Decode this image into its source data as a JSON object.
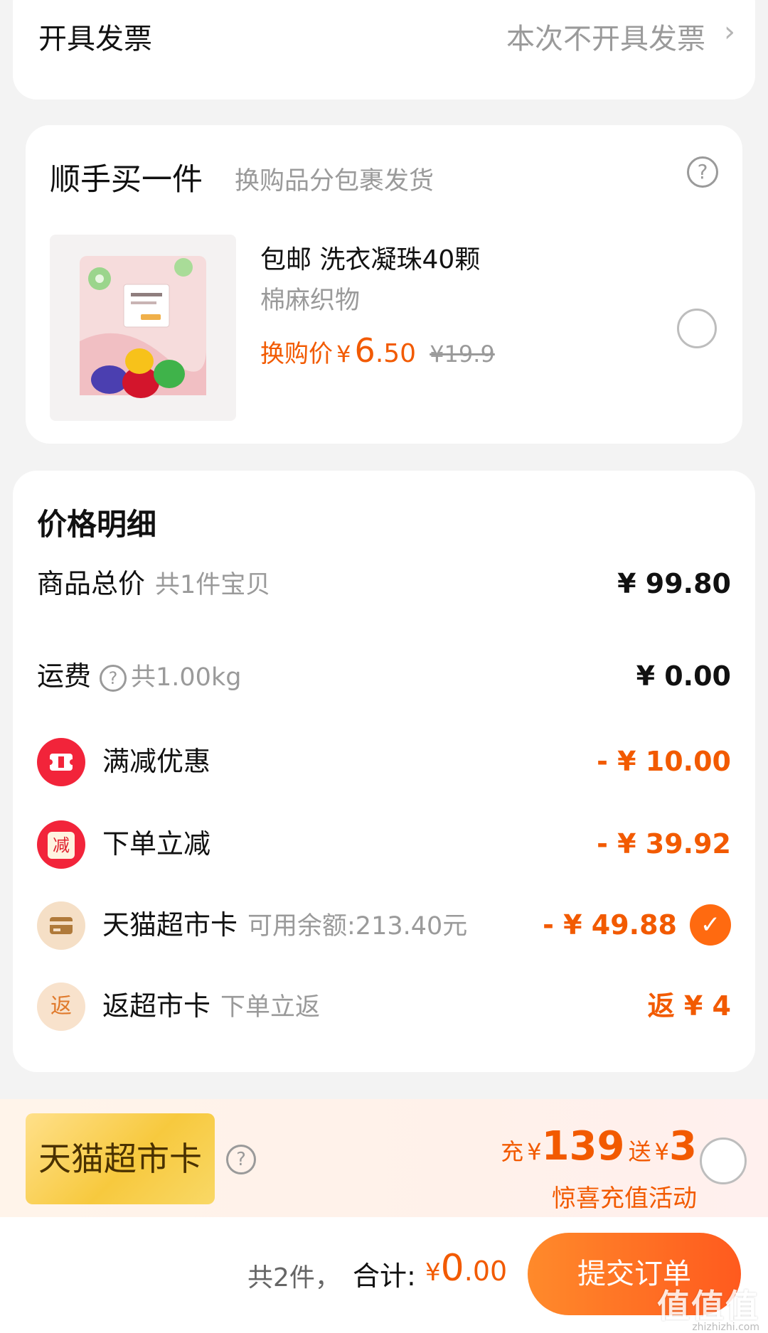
{
  "invoice": {
    "label": "开具发票",
    "value": "本次不开具发票",
    "chevron": "›"
  },
  "addon": {
    "title": "顺手买一件",
    "subtitle": "换购品分包裹发货",
    "help_icon": "?",
    "product": {
      "name": "包邮 洗衣凝珠40颗",
      "spec": "棉麻织物",
      "price_label": "换购价",
      "currency": "¥",
      "price_int": "6",
      "price_dec": ".50",
      "original_price": "¥19.9",
      "image_icon": "laundry-pods-bag-image"
    }
  },
  "details": {
    "title": "价格明细",
    "rows": [
      {
        "label": "商品总价",
        "note": "共1件宝贝",
        "amount": "¥ 99.80"
      },
      {
        "label": "运费",
        "help": "?",
        "note": "共1.00kg",
        "amount": "¥ 0.00"
      },
      {
        "label": "满减优惠",
        "icon": "ticket-icon",
        "amount": "- ¥ 10.00"
      },
      {
        "label": "下单立减",
        "icon_text": "减",
        "amount": "- ¥ 39.92"
      },
      {
        "label": "天猫超市卡",
        "icon": "card-icon",
        "note": "可用余额:213.40元",
        "amount": "- ¥ 49.88",
        "check": "✓"
      },
      {
        "label": "返超市卡",
        "icon_text": "返",
        "note": "下单立返",
        "amount": "返 ¥ 4"
      }
    ]
  },
  "recharge": {
    "badge": "天猫超市卡",
    "help": "?",
    "prefix": "充",
    "currency": "¥",
    "amount": "139",
    "gift_label": "送",
    "gift_amount": "3",
    "subtitle": "惊喜充值活动"
  },
  "bottom": {
    "count": "共2件，",
    "total_label": "合计:",
    "currency": "¥",
    "total_int": "0",
    "total_dec": ".00",
    "submit": "提交订单",
    "watermark": "值值值",
    "watermark_url": "zhizhizhi.com"
  },
  "colors": {
    "accent": "#f25a00",
    "button_start": "#ff8a2b",
    "button_end": "#ff5a1e",
    "red_icon": "#f2243a"
  }
}
